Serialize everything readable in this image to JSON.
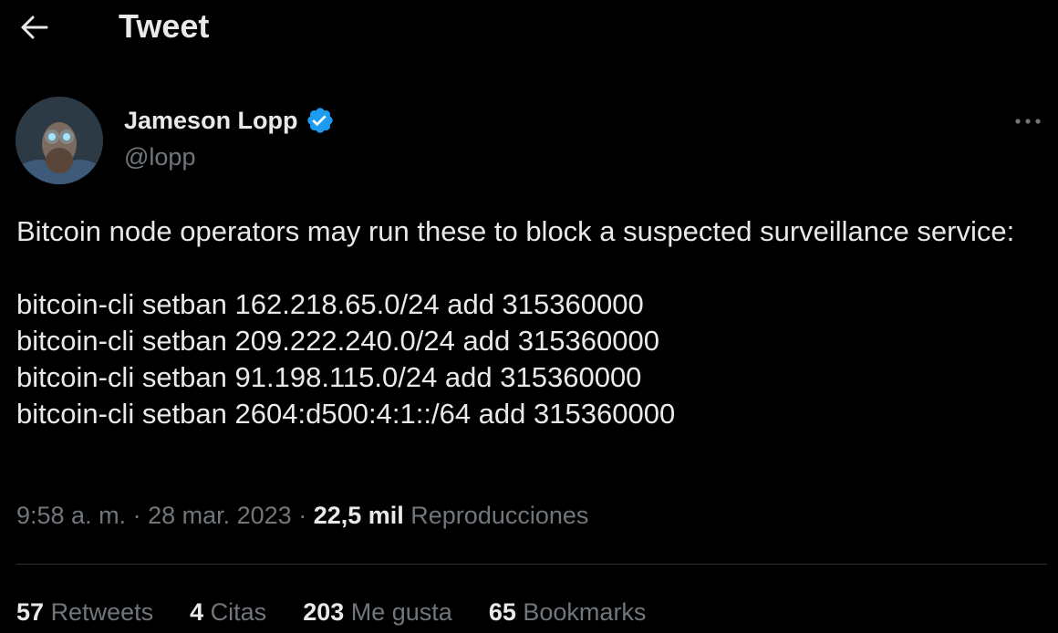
{
  "header": {
    "title": "Tweet",
    "back_icon": "arrow-left-icon"
  },
  "author": {
    "name": "Jameson Lopp",
    "handle": "@lopp",
    "verified_icon": "verified-badge-icon",
    "verified_color": "#1d9bf0",
    "more_icon": "more-horizontal-icon"
  },
  "tweet": {
    "intro": "Bitcoin node operators may run these to block a suspected surveillance service:",
    "commands": [
      "bitcoin-cli setban 162.218.65.0/24 add 315360000",
      "bitcoin-cli setban 209.222.240.0/24 add 315360000",
      "bitcoin-cli setban 91.198.115.0/24 add 315360000",
      "bitcoin-cli setban 2604:d500:4:1::/64 add 315360000"
    ]
  },
  "meta": {
    "time": "9:58 a. m.",
    "sep1": " · ",
    "date": "28 mar. 2023",
    "sep2": " · ",
    "views_count": "22,5 mil",
    "views_label": "Reproducciones"
  },
  "stats": [
    {
      "count": "57",
      "label": "Retweets"
    },
    {
      "count": "4",
      "label": "Citas"
    },
    {
      "count": "203",
      "label": "Me gusta"
    },
    {
      "count": "65",
      "label": "Bookmarks"
    }
  ],
  "colors": {
    "background": "#000000",
    "text_primary": "#e7e9ea",
    "text_secondary": "#71767b",
    "divider": "#2f3336",
    "accent": "#1d9bf0"
  }
}
